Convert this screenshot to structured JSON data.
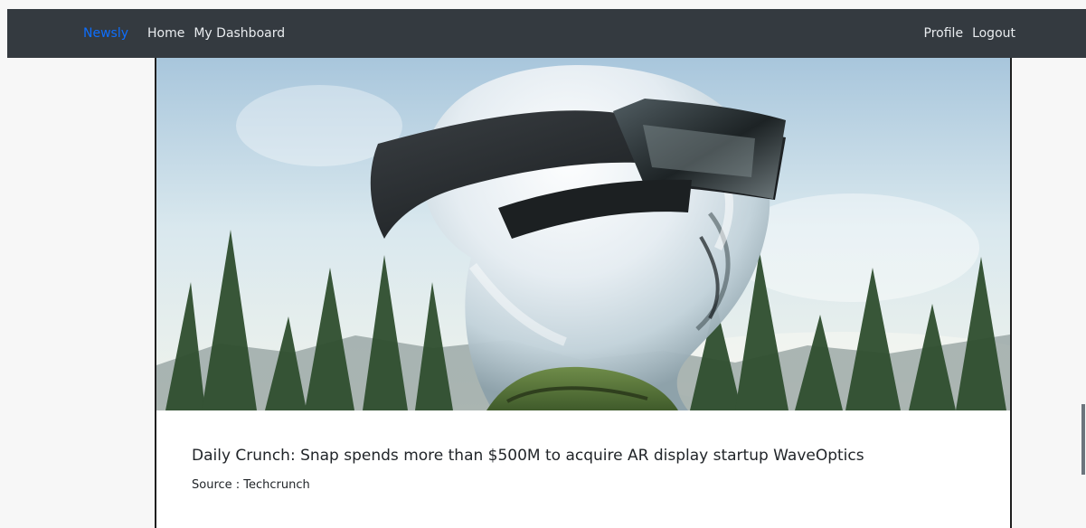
{
  "nav": {
    "brand": "Newsly",
    "left_links": [
      {
        "label": "Home"
      },
      {
        "label": "My Dashboard"
      }
    ],
    "right_links": [
      {
        "label": "Profile"
      },
      {
        "label": "Logout"
      }
    ]
  },
  "article": {
    "title": "Daily Crunch: Snap spends more than $500M to acquire AR display startup WaveOptics",
    "source": "Source : Techcrunch",
    "image_icon": "ar-glasses-hero-image"
  },
  "colors": {
    "navbar": "#343a40",
    "brand": "#0d6efd",
    "nav_text": "#e9ecef",
    "page_background": "#f7f7f7"
  }
}
